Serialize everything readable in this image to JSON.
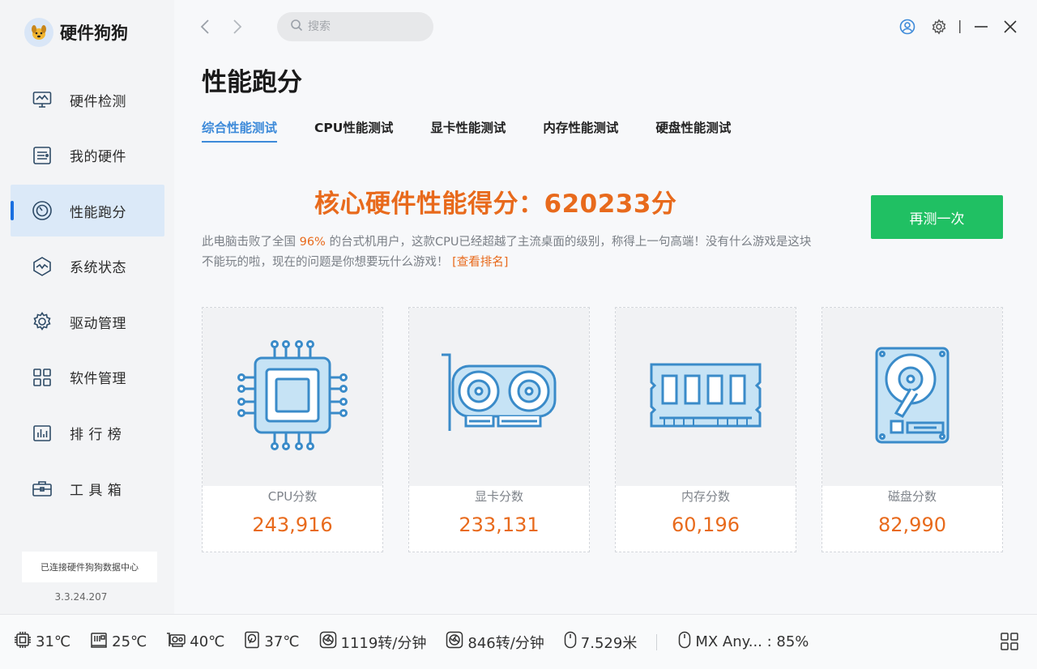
{
  "app": {
    "name": "硬件狗狗",
    "version": "3.3.24.207",
    "db_status": "已连接硬件狗狗数据中心"
  },
  "sidebar": {
    "items": [
      {
        "label": "硬件检测",
        "icon": "monitor-icon",
        "active": false
      },
      {
        "label": "我的硬件",
        "icon": "hardware-list-icon",
        "active": false
      },
      {
        "label": "性能跑分",
        "icon": "gauge-icon",
        "active": true
      },
      {
        "label": "系统状态",
        "icon": "pulse-icon",
        "active": false
      },
      {
        "label": "驱动管理",
        "icon": "gear-icon",
        "active": false
      },
      {
        "label": "软件管理",
        "icon": "apps-grid-icon",
        "active": false
      },
      {
        "label": "排 行 榜",
        "icon": "ranking-icon",
        "active": false
      },
      {
        "label": "工 具 箱",
        "icon": "toolbox-icon",
        "active": false
      }
    ]
  },
  "header": {
    "search_placeholder": "搜索"
  },
  "page": {
    "title": "性能跑分",
    "tabs": [
      "综合性能测试",
      "CPU性能测试",
      "显卡性能测试",
      "内存性能测试",
      "硬盘性能测试"
    ],
    "active_tab": 0,
    "score_text": "核心硬件性能得分：620233分",
    "retest_label": "再测一次",
    "desc_prefix": "此电脑击败了全国 ",
    "desc_percent": "96%",
    "desc_suffix": " 的台式机用户，这款CPU已经超越了主流桌面的级别，称得上一句高端！没有什么游戏是这块不能玩的啦，现在的问题是你想要玩什么游戏！ ",
    "desc_link": "[查看排名]",
    "cards": [
      {
        "label": "CPU分数",
        "value": "243,916",
        "icon": "cpu-chip-icon"
      },
      {
        "label": "显卡分数",
        "value": "233,131",
        "icon": "graphics-card-icon"
      },
      {
        "label": "内存分数",
        "value": "60,196",
        "icon": "memory-stick-icon"
      },
      {
        "label": "磁盘分数",
        "value": "82,990",
        "icon": "hard-disk-icon"
      }
    ]
  },
  "statusbar": {
    "cpu_temp": "31℃",
    "board_temp": "25℃",
    "gpu_temp": "40℃",
    "disk_temp": "37℃",
    "fan1": "1119转/分钟",
    "fan2": "846转/分钟",
    "mouse_distance": "7.529米",
    "mouse_battery": "MX Any... : 85%"
  },
  "colors": {
    "accent": "#3d8ad9",
    "score": "#e86a1c",
    "retest": "#20c063",
    "icon_stroke": "#3a8bc9",
    "icon_fill": "#c6e3f5"
  }
}
